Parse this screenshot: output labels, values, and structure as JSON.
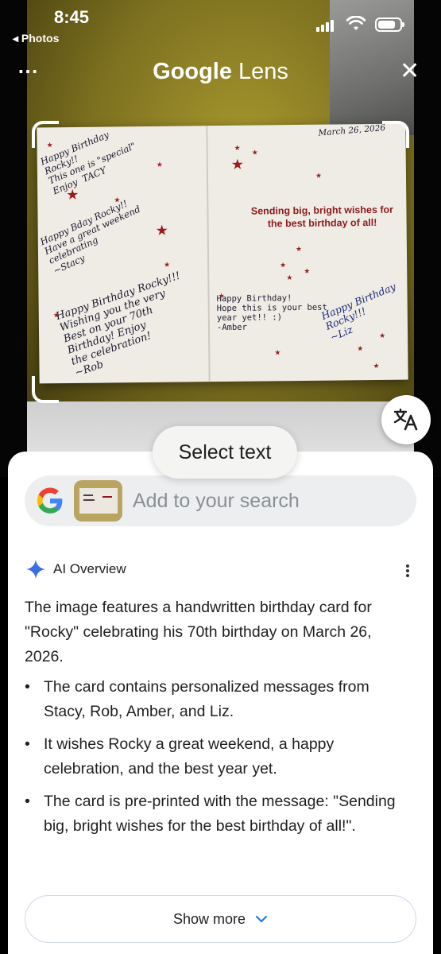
{
  "status_bar": {
    "time": "8:45",
    "back_app": "◂ Photos",
    "battery_level": 0.8
  },
  "header": {
    "title_brand": "Google",
    "title_product": "Lens",
    "more_icon": "⋯",
    "close_icon": "✕"
  },
  "card": {
    "date": "March 26, 2026",
    "printed_message": "Sending big, bright wishes for the best birthday of all!",
    "msg_tacy": "Happy Birthday\nRocky!!\nThis one is \"special\"\nEnjoy  TACY",
    "msg_stacy": "Happy Bday Rocky!!\nHave a great weekend\ncelebrating\n~Stacy",
    "msg_rob": "Happy Birthday Rocky!!!\nWishing you the very\nBest on your 70th\nBirthday! Enjoy\nthe celebration!\n~Rob",
    "msg_amber": "Happy Birthday!\nHope this is your best\nyear yet!! :)\n-Amber",
    "msg_liz": "Happy Birthday\nRocky!!!\n~Liz"
  },
  "select_text": "Select text",
  "search": {
    "placeholder": "Add to your search"
  },
  "ai_overview": {
    "label": "AI Overview",
    "summary": "The image features a handwritten birthday card for \"Rocky\" celebrating his 70th birthday on March 26, 2026.",
    "bullets": [
      "The card contains personalized messages from Stacy, Rob, Amber, and Liz.",
      "It wishes Rocky a great weekend, a happy celebration, and the best year yet.",
      "The card is pre-printed with the message: \"Sending big, bright wishes for the best birthday of all!\"."
    ]
  },
  "show_more": "Show more",
  "colors": {
    "accent_blue": "#1a73e8",
    "card_red": "#8b1a1a"
  }
}
